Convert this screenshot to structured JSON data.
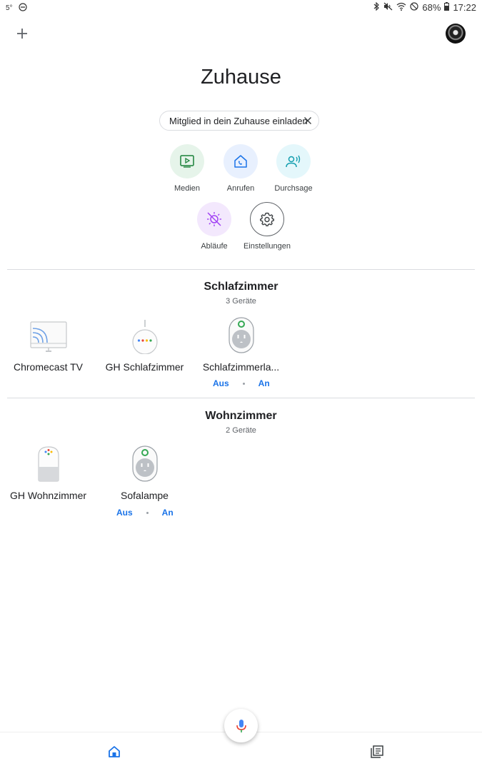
{
  "status_bar": {
    "temperature": "5°",
    "battery": "68%",
    "time": "17:22",
    "icons": [
      "do-not-disturb-icon",
      "bluetooth-icon",
      "mute-icon",
      "wifi-icon",
      "blocked-icon",
      "battery-icon"
    ]
  },
  "header": {
    "title": "Zuhause"
  },
  "invite_chip": {
    "label": "Mitglied in dein Zuhause einladen"
  },
  "actions": [
    {
      "label": "Medien",
      "icon": "media-play-icon",
      "bg": "#e6f4ea",
      "color": "#188038"
    },
    {
      "label": "Anrufen",
      "icon": "call-home-icon",
      "bg": "#e8f0fe",
      "color": "#1a73e8"
    },
    {
      "label": "Durchsage",
      "icon": "broadcast-icon",
      "bg": "#e4f7fb",
      "color": "#129eaf"
    },
    {
      "label": "Abläufe",
      "icon": "routines-icon",
      "bg": "#f3e8fd",
      "color": "#a142f4"
    },
    {
      "label": "Einstellungen",
      "icon": "settings-icon",
      "bg": "#ffffff",
      "color": "#5f6368"
    }
  ],
  "rooms": [
    {
      "name": "Schlafzimmer",
      "count": "3 Geräte",
      "devices": [
        {
          "name": "Chromecast TV",
          "icon": "chromecast-tv-icon"
        },
        {
          "name": "GH Schlafzimmer",
          "icon": "google-home-mini-icon"
        },
        {
          "name": "Schlafzimmerla...",
          "icon": "smart-plug-icon",
          "off_label": "Aus",
          "on_label": "An"
        }
      ]
    },
    {
      "name": "Wohnzimmer",
      "count": "2 Geräte",
      "devices": [
        {
          "name": "GH Wohnzimmer",
          "icon": "google-home-speaker-icon"
        },
        {
          "name": "Sofalampe",
          "icon": "smart-plug-icon",
          "off_label": "Aus",
          "on_label": "An"
        }
      ]
    }
  ],
  "bottom_nav": {
    "items": [
      {
        "icon": "home-icon",
        "active": true
      },
      {
        "icon": "feed-icon",
        "active": false
      }
    ]
  },
  "colors": {
    "accent": "#1a73e8",
    "divider": "#dadce0"
  }
}
